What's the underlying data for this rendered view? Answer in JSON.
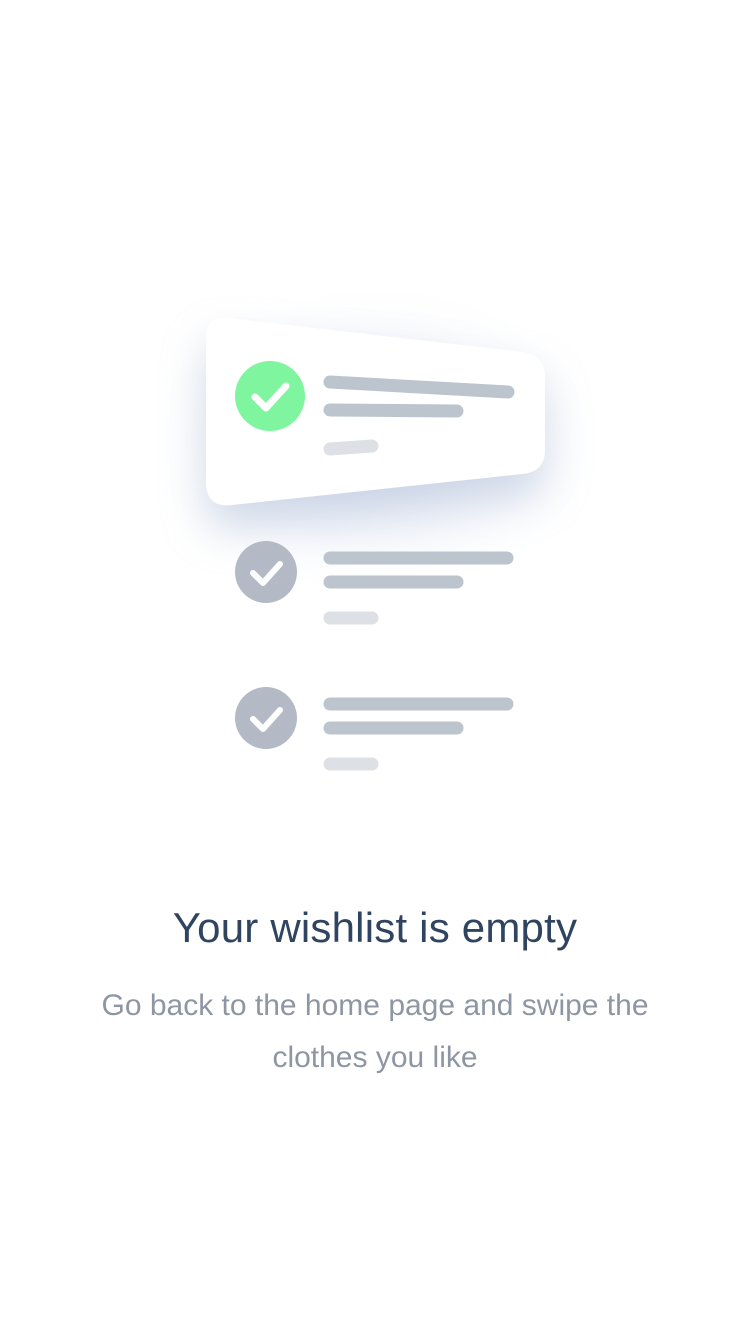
{
  "empty_state": {
    "title": "Your wishlist is empty",
    "message": "Go back to the home page and swipe the clothes you like"
  },
  "illustration": {
    "items": [
      {
        "state": "highlighted",
        "icon": "check-icon"
      },
      {
        "state": "muted",
        "icon": "check-icon"
      },
      {
        "state": "muted",
        "icon": "check-icon"
      }
    ]
  },
  "colors": {
    "highlight": "#7ff59f",
    "muted_circle": "#b3bac5",
    "line": "#bcc4ce",
    "line_light": "#dde1e6",
    "title": "#2f4460",
    "message": "#8e96a3"
  }
}
